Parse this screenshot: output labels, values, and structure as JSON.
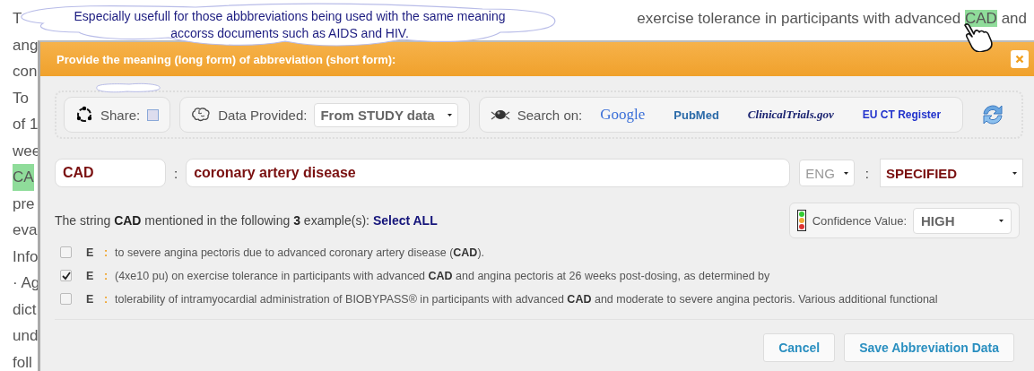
{
  "background_document": {
    "top_line": {
      "start": "T",
      "segments": [
        {
          "text": "exercise tolerance in participants with advanced ",
          "highlighted": false
        },
        {
          "text": "CAD",
          "highlighted": true
        },
        {
          "text": " and",
          "highlighted": false
        }
      ]
    },
    "line_starts": [
      {
        "text": "ang",
        "highlighted": false
      },
      {
        "text": "con",
        "highlighted": false
      },
      {
        "text": "To",
        "highlighted": false
      },
      {
        "text": "of 1",
        "highlighted": false
      },
      {
        "text": "wee",
        "highlighted": false
      },
      {
        "text": "CA",
        "highlighted": true
      },
      {
        "text": "pre",
        "highlighted": false
      },
      {
        "text": "eva",
        "highlighted": false
      },
      {
        "text": "Info",
        "highlighted": false
      },
      {
        "text": "· Ag",
        "highlighted": false
      },
      {
        "text": "dict",
        "highlighted": false
      },
      {
        "text": "und",
        "highlighted": false
      },
      {
        "text": "foll",
        "highlighted": false
      }
    ]
  },
  "callout": {
    "lines": [
      "Especially usefull for those abbbreviations being used with the same meaning",
      "accorss documents such as AIDS and HIV."
    ]
  },
  "dialog": {
    "title": "Provide the meaning (long form) of abbreviation (short form):",
    "toolbar": {
      "share": {
        "label": "Share:",
        "checked": false
      },
      "data_provided": {
        "label": "Data Provided:",
        "value": "From STUDY data"
      },
      "search": {
        "label": "Search on:",
        "links": [
          {
            "text": "Google",
            "kind": "google"
          },
          {
            "text": "PubMed",
            "kind": "pubmed"
          },
          {
            "text": "ClinicalTrials.gov",
            "kind": "clinical"
          },
          {
            "text": "EU CT Register",
            "kind": "eu"
          }
        ]
      }
    },
    "abbreviation": {
      "short_form": "CAD",
      "separators": [
        ":",
        ":"
      ],
      "long_form": "coronary artery disease",
      "language": "ENG",
      "status": "SPECIFIED"
    },
    "summary": "The string **CAD** mentioned in the following **3** example(s): ",
    "select_all": "Select ALL",
    "confidence": {
      "label": "Confidence Value:",
      "value": "HIGH"
    },
    "examples": [
      {
        "checked": false,
        "label": "E",
        "separator": ":",
        "text": "to severe angina pectoris due to advanced coronary artery disease (**CAD**)."
      },
      {
        "checked": true,
        "label": "E",
        "separator": ":",
        "text": "(4xe10 pu) on exercise tolerance in participants with advanced **CAD** and angina pectoris at 26 weeks post-dosing, as determined by"
      },
      {
        "checked": false,
        "label": "E",
        "separator": ":",
        "text": "tolerability of intramyocardial administration of BIOBYPASS® in participants with advanced **CAD** and moderate to severe angina pectoris. Various additional functional"
      }
    ],
    "buttons": [
      "Cancel",
      "Save Abbreviation Data"
    ]
  }
}
